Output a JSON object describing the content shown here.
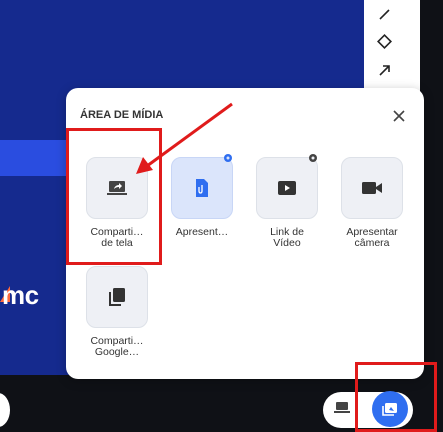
{
  "popup": {
    "title": "ÁREA DE MÍDIA",
    "tiles": [
      {
        "label": "Comparti… de tela",
        "line1": "Comparti…",
        "line2": "de tela",
        "icon": "screen-share-icon"
      },
      {
        "label": "Apresent…",
        "line1": "Apresent…",
        "line2": "",
        "icon": "presentation-file-icon"
      },
      {
        "label": "Link de Vídeo",
        "line1": "Link de",
        "line2": "Vídeo",
        "icon": "video-link-icon"
      },
      {
        "label": "Apresentar câmera",
        "line1": "Apresentar",
        "line2": "câmera",
        "icon": "camera-icon"
      },
      {
        "label": "Comparti… Google…",
        "line1": "Comparti…",
        "line2": "Google…",
        "icon": "copy-icon"
      }
    ]
  },
  "background": {
    "logo_text": "mc"
  },
  "colors": {
    "primary": "#2f6ef0",
    "annotation": "#e01b1b",
    "background_blue": "#152a8e"
  }
}
